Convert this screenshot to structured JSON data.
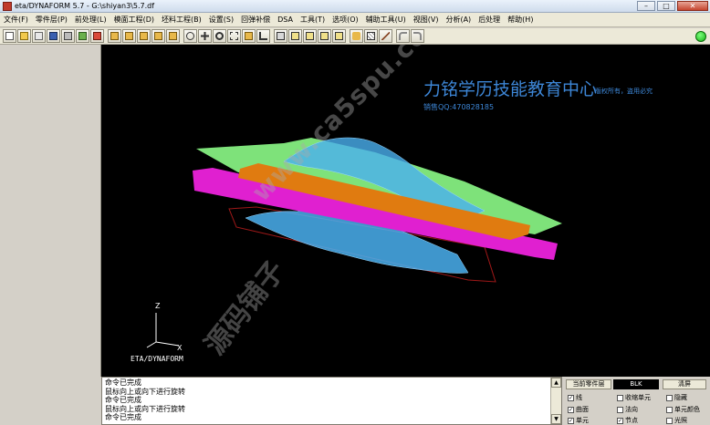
{
  "window": {
    "title": "eta/DYNAFORM 5.7  - G:\\shiyan3\\5.7.df",
    "minimize": "–",
    "maximize": "□",
    "close": "✕"
  },
  "menu": [
    "文件(F)",
    "零件层(P)",
    "前处理(L)",
    "模面工程(D)",
    "坯料工程(B)",
    "设置(S)",
    "回弹补偿",
    "DSA",
    "工具(T)",
    "选项(O)",
    "辅助工具(U)",
    "视图(V)",
    "分析(A)",
    "后处理",
    "帮助(H)"
  ],
  "toolbar_icons": [
    "new-file",
    "open-folder",
    "copy",
    "save",
    "print",
    "import",
    "part-a",
    "part-b",
    "part-c",
    "part-d",
    "part-e",
    "rotate",
    "pan",
    "zoom",
    "fit",
    "move",
    "select",
    "view-iso",
    "view-front",
    "view-side",
    "view-top",
    "shade",
    "wire",
    "pick",
    "undo",
    "redo"
  ],
  "viewport": {
    "watermark_title": "力铭学历技能教育中心",
    "watermark_rights": "版权所有，盗用必究",
    "watermark_sales": "销售QQ:470828185",
    "watermark_url": "www.ca5spu.com",
    "watermark_shop": "源码铺子",
    "axis_z": "Z",
    "axis_x": "X",
    "brand": "ETA/DYNAFORM"
  },
  "command_log": [
    "命令已完成",
    "鼠标向上或向下进行旋转",
    "命令已完成",
    "鼠标向上或向下进行旋转",
    "命令已完成"
  ],
  "display_panel": {
    "current_part_label": "当前零件层",
    "current_part_value": "BLK",
    "clear_label": "清屏",
    "options": [
      {
        "label": "线",
        "checked": true
      },
      {
        "label": "收缩单元",
        "checked": false
      },
      {
        "label": "隐藏",
        "checked": false
      },
      {
        "label": "曲面",
        "checked": true
      },
      {
        "label": "法向",
        "checked": false
      },
      {
        "label": "单元颜色",
        "checked": false
      },
      {
        "label": "单元",
        "checked": true
      },
      {
        "label": "节点",
        "checked": true
      },
      {
        "label": "光照",
        "checked": false
      }
    ]
  },
  "colors": {
    "binder_green": "#7ee27a",
    "blank_orange": "#e07b10",
    "holder_magenta": "#e020d0",
    "tool_blue": "#4ab0f0",
    "outline_red": "#a01818",
    "status_green": "#15b215"
  }
}
